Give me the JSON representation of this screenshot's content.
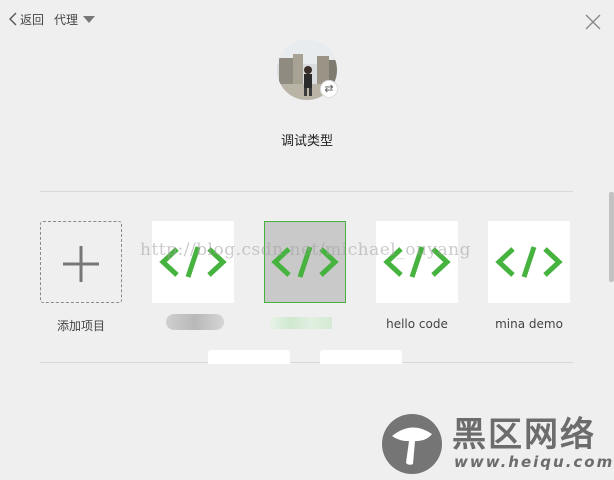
{
  "header": {
    "back_label": "返回",
    "proxy_label": "代理"
  },
  "profile": {
    "switch_glyph": "⇄"
  },
  "debug_type_title": "调试类型",
  "projects": [
    {
      "label": "添加项目",
      "icon": "plus-icon"
    },
    {
      "label": "",
      "icon": "code-icon"
    },
    {
      "label": "",
      "icon": "code-icon",
      "selected": true
    },
    {
      "label": "hello code",
      "icon": "code-icon"
    },
    {
      "label": "mina demo",
      "icon": "code-icon"
    }
  ],
  "watermark": "http://blog.csdn.net/michael_ouyang",
  "logo": {
    "name": "黑区网络",
    "url": "www.heiqu.com"
  },
  "colors": {
    "accent_green": "#46b33e",
    "background": "#efefef"
  }
}
